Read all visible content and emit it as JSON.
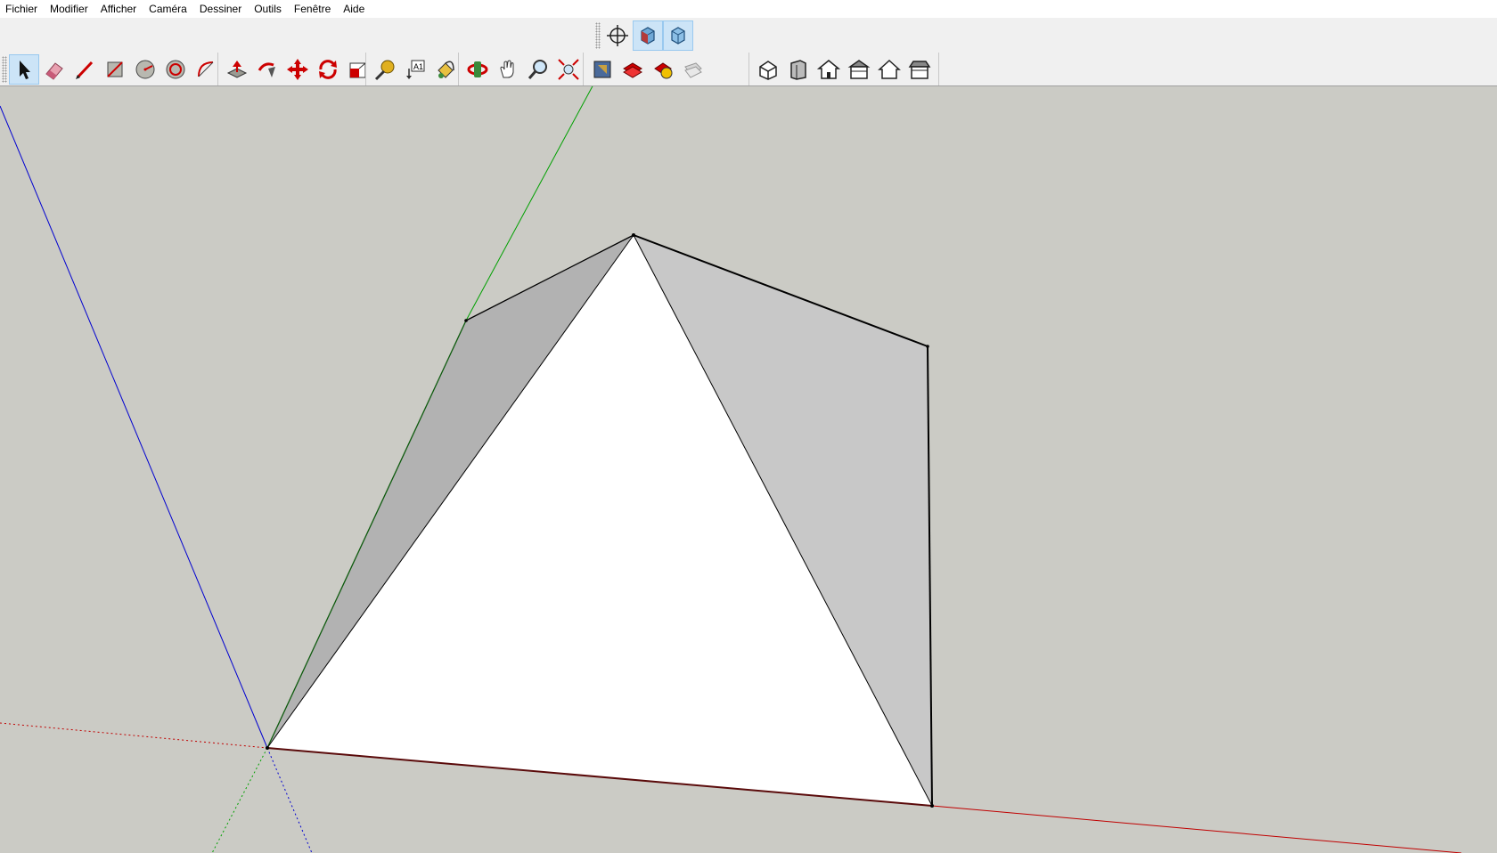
{
  "menu": {
    "items": [
      {
        "id": "file",
        "label": "Fichier"
      },
      {
        "id": "edit",
        "label": "Modifier"
      },
      {
        "id": "view",
        "label": "Afficher"
      },
      {
        "id": "camera",
        "label": "Caméra"
      },
      {
        "id": "draw",
        "label": "Dessiner"
      },
      {
        "id": "tools",
        "label": "Outils"
      },
      {
        "id": "window",
        "label": "Fenêtre"
      },
      {
        "id": "help",
        "label": "Aide"
      }
    ]
  },
  "toolbar_top": {
    "tools": [
      {
        "icon": "axes-icon",
        "active": false
      },
      {
        "icon": "perspective-icon",
        "active": true
      },
      {
        "icon": "iso-view-icon",
        "active": true
      }
    ]
  },
  "toolbar_main": {
    "groups": [
      [
        "select-arrow-icon",
        "eraser-icon",
        "pencil-icon",
        "rectangle-icon",
        "circle-icon",
        "polygon-icon",
        "arc-icon"
      ],
      [
        "push-pull-icon",
        "follow-me-icon",
        "move-icon",
        "rotate-icon",
        "scale-icon"
      ],
      [
        "tape-measure-icon",
        "text-label-icon",
        "paint-bucket-icon"
      ],
      [
        "orbit-icon",
        "pan-hand-icon",
        "zoom-icon",
        "zoom-extents-icon"
      ],
      [
        "3d-warehouse-icon",
        "extension-warehouse-icon",
        "layout-send-icon",
        "extension-manager-icon"
      ],
      [
        "iso-standard-view-icon",
        "front-view-icon",
        "top-view-icon",
        "right-view-icon",
        "back-view-icon",
        "left-view-icon"
      ]
    ],
    "active_tool": "select-arrow-icon"
  },
  "colors": {
    "background": "#cbcbc5",
    "x_axis": "#c00000",
    "y_axis": "#00a000",
    "z_axis": "#0000d0",
    "face_front": "#ffffff",
    "face_side_light": "#c8c8c8",
    "face_side_dark": "#b2b2b2",
    "edge": "#000000"
  }
}
